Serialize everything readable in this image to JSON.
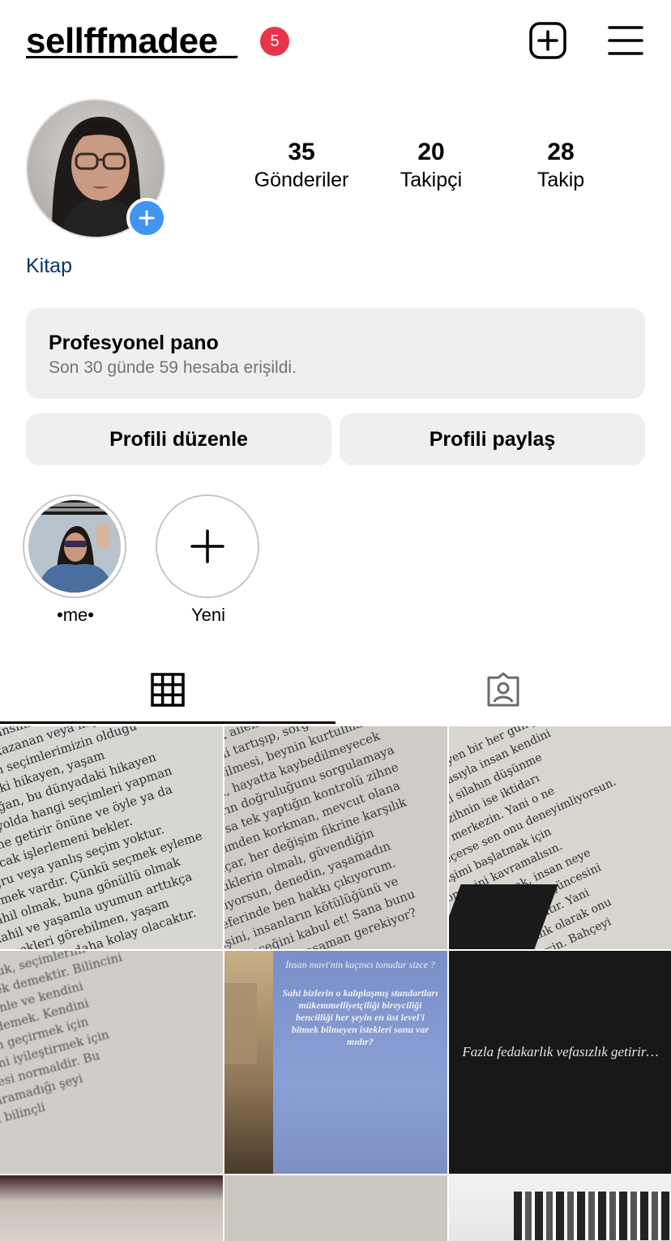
{
  "header": {
    "username": "sellffmadee_",
    "notification_count": "5",
    "add_icon": "plus-square-icon",
    "menu_icon": "hamburger-menu-icon"
  },
  "profile": {
    "stats": [
      {
        "value": "35",
        "label": "Gönderiler"
      },
      {
        "value": "20",
        "label": "Takipçi"
      },
      {
        "value": "28",
        "label": "Takip"
      }
    ],
    "category": "Kitap"
  },
  "dashboard": {
    "title": "Profesyonel pano",
    "subtitle": "Son 30 günde 59 hesaba erişildi."
  },
  "actions": {
    "edit_label": "Profili düzenle",
    "share_label": "Profili paylaş"
  },
  "highlights": [
    {
      "label": "•me•"
    },
    {
      "label": "Yeni"
    }
  ],
  "tabs": [
    {
      "icon": "grid-icon",
      "active": true
    },
    {
      "icon": "tagged-user-icon",
      "active": false
    }
  ],
  "posts": {
    "quote_dark": "Fazla fedakarlık vefasızlık getirir…",
    "poster_title": "İnsan mavi'nin kaçıncı tonudur sizce ?",
    "poster_heading": "Sahi bizlerin o kalıplaşmış standartları mükemmelliyetçiliği bireyciliği bencilliği her şeyin en üst level'i bitmek bilmeyen istekleri sonu var mıdır?"
  },
  "colors": {
    "badge": "#e8344a",
    "link": "#00376b",
    "add_avatar": "#4195f2",
    "panel": "#efefef"
  }
}
